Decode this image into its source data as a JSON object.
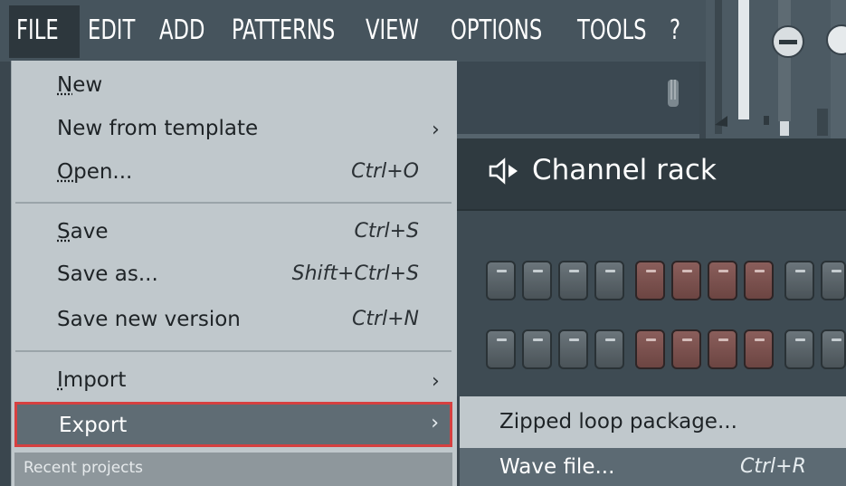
{
  "menubar": {
    "items": [
      "FILE",
      "EDIT",
      "ADD",
      "PATTERNS",
      "VIEW",
      "OPTIONS",
      "TOOLS",
      "?"
    ]
  },
  "channel_rack": {
    "title": "Channel rack"
  },
  "file_menu": {
    "new": "New",
    "new_from_template": "New from template",
    "open": "Open...",
    "open_shortcut": "Ctrl+O",
    "save": "Save",
    "save_shortcut": "Ctrl+S",
    "save_as": "Save as...",
    "save_as_shortcut": "Shift+Ctrl+S",
    "save_new_version": "Save new version",
    "save_new_version_shortcut": "Ctrl+N",
    "import": "Import",
    "export": "Export",
    "recent_projects": "Recent projects"
  },
  "export_submenu": {
    "zipped_loop_package": "Zipped loop package...",
    "wave_file": "Wave file...",
    "wave_file_shortcut": "Ctrl+R"
  },
  "colors": {
    "highlight_border": "#d64040",
    "menu_bg": "#c0c8cc",
    "menubar_bg": "#46545d"
  }
}
